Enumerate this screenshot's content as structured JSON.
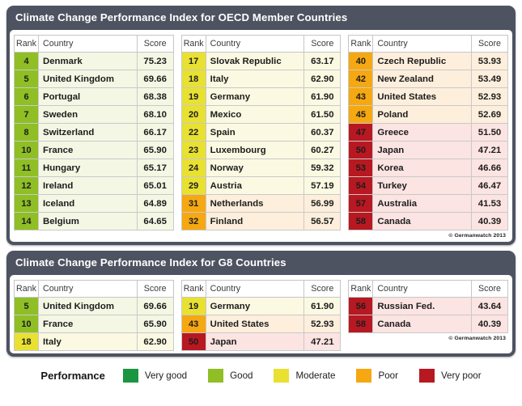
{
  "panels": [
    {
      "title": "Climate Change Performance Index for OECD Member Countries",
      "credit": "© Germanwatch 2013",
      "headers": {
        "rank": "Rank",
        "country": "Country",
        "score": "Score"
      },
      "columns": [
        {
          "rows": [
            {
              "rank": "4",
              "country": "Denmark",
              "score": "75.23",
              "performance": "good"
            },
            {
              "rank": "5",
              "country": "United Kingdom",
              "score": "69.66",
              "performance": "good"
            },
            {
              "rank": "6",
              "country": "Portugal",
              "score": "68.38",
              "performance": "good"
            },
            {
              "rank": "7",
              "country": "Sweden",
              "score": "68.10",
              "performance": "good"
            },
            {
              "rank": "8",
              "country": "Switzerland",
              "score": "66.17",
              "performance": "good"
            },
            {
              "rank": "10",
              "country": "France",
              "score": "65.90",
              "performance": "good"
            },
            {
              "rank": "11",
              "country": "Hungary",
              "score": "65.17",
              "performance": "good"
            },
            {
              "rank": "12",
              "country": "Ireland",
              "score": "65.01",
              "performance": "good"
            },
            {
              "rank": "13",
              "country": "Iceland",
              "score": "64.89",
              "performance": "good"
            },
            {
              "rank": "14",
              "country": "Belgium",
              "score": "64.65",
              "performance": "good"
            }
          ]
        },
        {
          "rows": [
            {
              "rank": "17",
              "country": "Slovak Republic",
              "score": "63.17",
              "performance": "moderate"
            },
            {
              "rank": "18",
              "country": "Italy",
              "score": "62.90",
              "performance": "moderate"
            },
            {
              "rank": "19",
              "country": "Germany",
              "score": "61.90",
              "performance": "moderate"
            },
            {
              "rank": "20",
              "country": "Mexico",
              "score": "61.50",
              "performance": "moderate"
            },
            {
              "rank": "22",
              "country": "Spain",
              "score": "60.37",
              "performance": "moderate"
            },
            {
              "rank": "23",
              "country": "Luxembourg",
              "score": "60.27",
              "performance": "moderate"
            },
            {
              "rank": "24",
              "country": "Norway",
              "score": "59.32",
              "performance": "moderate"
            },
            {
              "rank": "29",
              "country": "Austria",
              "score": "57.19",
              "performance": "moderate"
            },
            {
              "rank": "31",
              "country": "Netherlands",
              "score": "56.99",
              "performance": "poor"
            },
            {
              "rank": "32",
              "country": "Finland",
              "score": "56.57",
              "performance": "poor"
            }
          ]
        },
        {
          "rows": [
            {
              "rank": "40",
              "country": "Czech Republic",
              "score": "53.93",
              "performance": "poor"
            },
            {
              "rank": "42",
              "country": "New Zealand",
              "score": "53.49",
              "performance": "poor"
            },
            {
              "rank": "43",
              "country": "United States",
              "score": "52.93",
              "performance": "poor"
            },
            {
              "rank": "45",
              "country": "Poland",
              "score": "52.69",
              "performance": "poor"
            },
            {
              "rank": "47",
              "country": "Greece",
              "score": "51.50",
              "performance": "verypoor"
            },
            {
              "rank": "50",
              "country": "Japan",
              "score": "47.21",
              "performance": "verypoor"
            },
            {
              "rank": "53",
              "country": "Korea",
              "score": "46.66",
              "performance": "verypoor"
            },
            {
              "rank": "54",
              "country": "Turkey",
              "score": "46.47",
              "performance": "verypoor"
            },
            {
              "rank": "57",
              "country": "Australia",
              "score": "41.53",
              "performance": "verypoor"
            },
            {
              "rank": "58",
              "country": "Canada",
              "score": "40.39",
              "performance": "verypoor"
            }
          ]
        }
      ]
    },
    {
      "title": "Climate Change Performance Index for G8 Countries",
      "credit": "© Germanwatch 2013",
      "headers": {
        "rank": "Rank",
        "country": "Country",
        "score": "Score"
      },
      "columns": [
        {
          "rows": [
            {
              "rank": "5",
              "country": "United Kingdom",
              "score": "69.66",
              "performance": "good"
            },
            {
              "rank": "10",
              "country": "France",
              "score": "65.90",
              "performance": "good"
            },
            {
              "rank": "18",
              "country": "Italy",
              "score": "62.90",
              "performance": "moderate"
            }
          ]
        },
        {
          "rows": [
            {
              "rank": "19",
              "country": "Germany",
              "score": "61.90",
              "performance": "moderate"
            },
            {
              "rank": "43",
              "country": "United States",
              "score": "52.93",
              "performance": "poor"
            },
            {
              "rank": "50",
              "country": "Japan",
              "score": "47.21",
              "performance": "verypoor"
            }
          ]
        },
        {
          "rows": [
            {
              "rank": "56",
              "country": "Russian Fed.",
              "score": "43.64",
              "performance": "verypoor"
            },
            {
              "rank": "58",
              "country": "Canada",
              "score": "40.39",
              "performance": "verypoor"
            }
          ]
        }
      ]
    }
  ],
  "legend": {
    "title": "Performance",
    "items": [
      {
        "label": "Very good",
        "color": "#1a9641",
        "key": "verygood"
      },
      {
        "label": "Good",
        "color": "#8fbf25",
        "key": "good"
      },
      {
        "label": "Moderate",
        "color": "#e8e132",
        "key": "moderate"
      },
      {
        "label": "Poor",
        "color": "#f5a811",
        "key": "poor"
      },
      {
        "label": "Very poor",
        "color": "#b81821",
        "key": "verypoor"
      }
    ]
  },
  "chart_data": {
    "type": "table",
    "title": "Climate Change Performance Index 2013",
    "series": [
      {
        "name": "OECD Member Countries",
        "categories": [
          "Denmark",
          "United Kingdom",
          "Portugal",
          "Sweden",
          "Switzerland",
          "France",
          "Hungary",
          "Ireland",
          "Iceland",
          "Belgium",
          "Slovak Republic",
          "Italy",
          "Germany",
          "Mexico",
          "Spain",
          "Luxembourg",
          "Norway",
          "Austria",
          "Netherlands",
          "Finland",
          "Czech Republic",
          "New Zealand",
          "United States",
          "Poland",
          "Greece",
          "Japan",
          "Korea",
          "Turkey",
          "Australia",
          "Canada"
        ],
        "ranks": [
          4,
          5,
          6,
          7,
          8,
          10,
          11,
          12,
          13,
          14,
          17,
          18,
          19,
          20,
          22,
          23,
          24,
          29,
          31,
          32,
          40,
          42,
          43,
          45,
          47,
          50,
          53,
          54,
          57,
          58
        ],
        "values": [
          75.23,
          69.66,
          68.38,
          68.1,
          66.17,
          65.9,
          65.17,
          65.01,
          64.89,
          64.65,
          63.17,
          62.9,
          61.9,
          61.5,
          60.37,
          60.27,
          59.32,
          57.19,
          56.99,
          56.57,
          53.93,
          53.49,
          52.93,
          52.69,
          51.5,
          47.21,
          46.66,
          46.47,
          41.53,
          40.39
        ],
        "performance": [
          "good",
          "good",
          "good",
          "good",
          "good",
          "good",
          "good",
          "good",
          "good",
          "good",
          "moderate",
          "moderate",
          "moderate",
          "moderate",
          "moderate",
          "moderate",
          "moderate",
          "moderate",
          "poor",
          "poor",
          "poor",
          "poor",
          "poor",
          "poor",
          "verypoor",
          "verypoor",
          "verypoor",
          "verypoor",
          "verypoor",
          "verypoor"
        ]
      },
      {
        "name": "G8 Countries",
        "categories": [
          "United Kingdom",
          "France",
          "Italy",
          "Germany",
          "United States",
          "Japan",
          "Russian Fed.",
          "Canada"
        ],
        "ranks": [
          5,
          10,
          18,
          19,
          43,
          50,
          56,
          58
        ],
        "values": [
          69.66,
          65.9,
          62.9,
          61.9,
          52.93,
          47.21,
          43.64,
          40.39
        ],
        "performance": [
          "good",
          "good",
          "moderate",
          "moderate",
          "poor",
          "verypoor",
          "verypoor",
          "verypoor"
        ]
      }
    ],
    "ylabel": "Score",
    "xlabel": "Country"
  }
}
